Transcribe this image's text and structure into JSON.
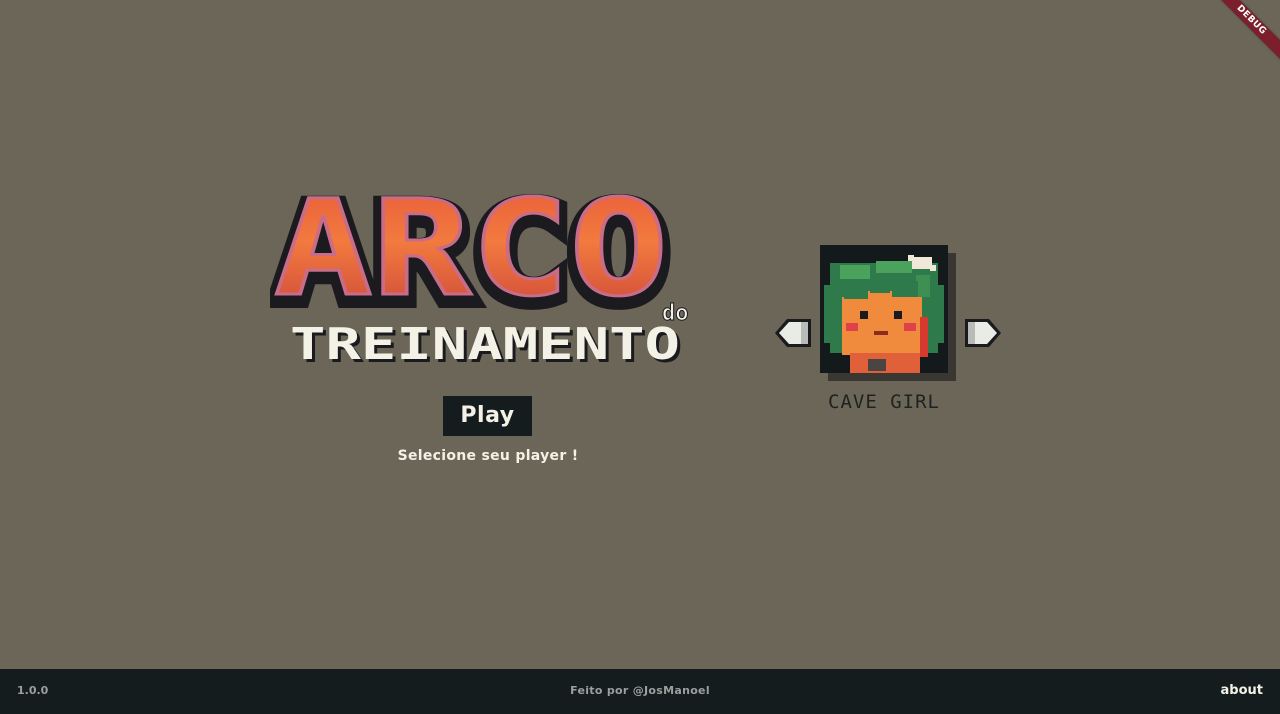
{
  "debug_banner": {
    "label": "DEBUG"
  },
  "title": {
    "main": "ARCO",
    "connector": "do",
    "sub": "TREINAMENTO"
  },
  "menu": {
    "play_label": "Play",
    "hint": "Selecione seu player !"
  },
  "character_select": {
    "character_name": "CAVE GIRL",
    "prev_icon": "arrow-left-icon",
    "next_icon": "arrow-right-icon"
  },
  "footer": {
    "version": "1.0.0",
    "credits": "Feito por @JosManoel",
    "about_label": "about"
  },
  "colors": {
    "background": "#6b6658",
    "footer": "#141c1d",
    "title_orange": "#f0703c",
    "title_dark": "#1b1a1e",
    "text_light": "#f4f1e6"
  }
}
